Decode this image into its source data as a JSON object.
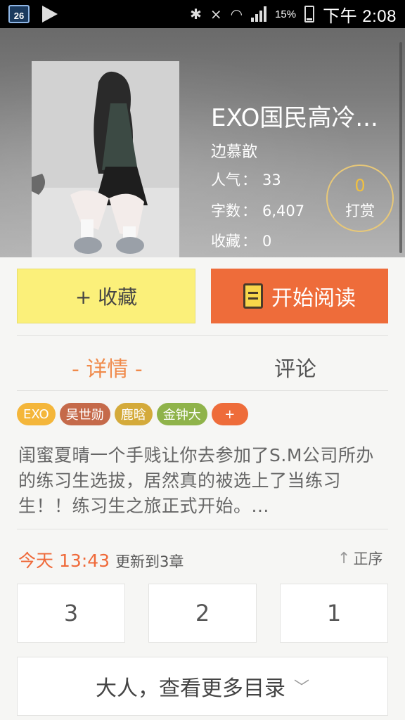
{
  "status_bar": {
    "calendar_day": "26",
    "battery_pct": "15%",
    "time": "下午 2:08",
    "icons": [
      "calendar-icon",
      "play-icon",
      "bluetooth-icon",
      "mute-icon",
      "wifi-icon",
      "signal-icon",
      "battery-icon"
    ]
  },
  "book": {
    "title": "EXO国民高冷...",
    "author": "边慕歆",
    "popularity_label": "人气",
    "popularity": "33",
    "words_label": "字数",
    "words": "6,407",
    "favorites_label": "收藏",
    "favorites": "0",
    "tip_count": "0",
    "tip_label": "打赏"
  },
  "actions": {
    "favorite_label": "+ 收藏",
    "read_label": "开始阅读"
  },
  "tabs": {
    "detail": "- 详情 -",
    "comments": "评论"
  },
  "tags": [
    {
      "label": "EXO",
      "color": "#f4b63a"
    },
    {
      "label": "吴世勋",
      "color": "#c56a4a"
    },
    {
      "label": "鹿晗",
      "color": "#d4aa3a"
    },
    {
      "label": "金钟大",
      "color": "#8fb34a"
    },
    {
      "label": "+",
      "color": "#ee6c3a"
    }
  ],
  "description": "闺蜜夏晴一个手贱让你去参加了S.M公司所办的练习生选拔，居然真的被选上了当练习生！！练习生之旅正式开始。...",
  "update": {
    "day": "今天",
    "time": "13:43",
    "text": "更新到3章",
    "sort_label": "正序"
  },
  "chapters": [
    "3",
    "2",
    "1"
  ],
  "more_label": "大人，查看更多目录",
  "colors": {
    "accent_orange": "#ee6c3a",
    "favorite_yellow": "#fbf07a",
    "tip_gold": "#f0c040"
  }
}
